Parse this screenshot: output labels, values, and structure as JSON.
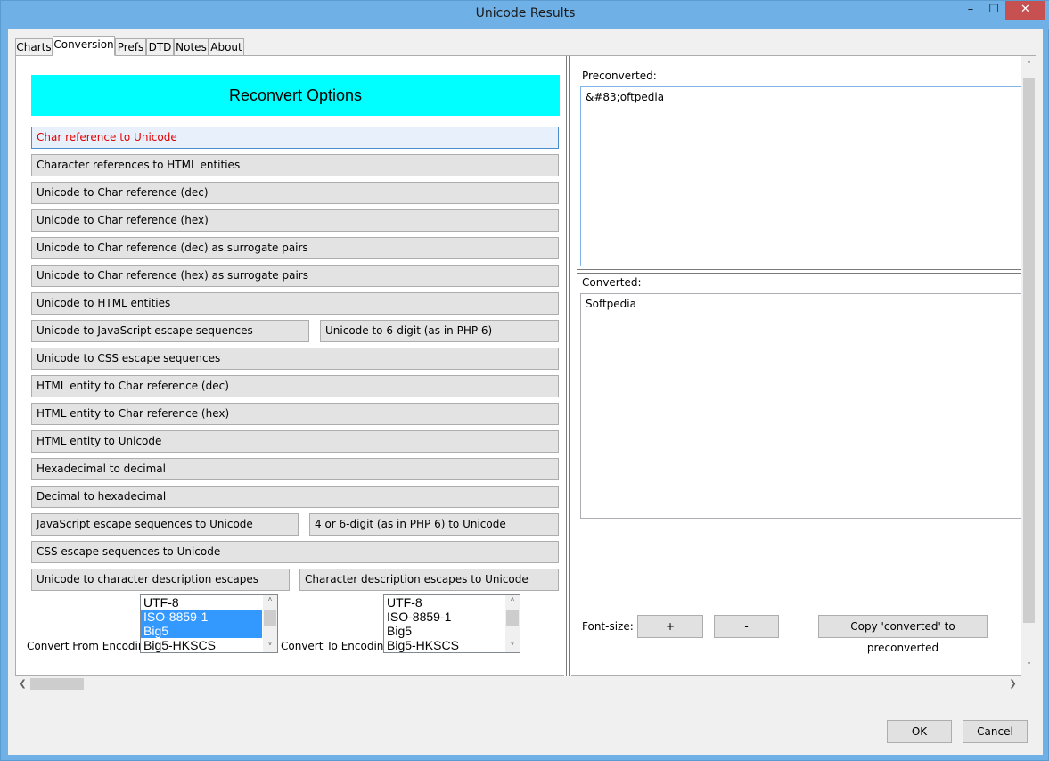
{
  "window": {
    "title": "Unicode Results",
    "minimize_glyph": "–",
    "maximize_glyph": "☐",
    "close_glyph": "✕"
  },
  "tabs": [
    {
      "label": "Charts",
      "active": false
    },
    {
      "label": "Conversion",
      "active": true
    },
    {
      "label": "Prefs",
      "active": false
    },
    {
      "label": "DTD",
      "active": false
    },
    {
      "label": "Notes",
      "active": false
    },
    {
      "label": "About",
      "active": false
    }
  ],
  "conversion": {
    "banner": "Reconvert Options",
    "banner_color": "#00ffff",
    "buttons": [
      "Char reference to Unicode",
      "Character references to HTML entities",
      "Unicode to Char reference (dec)",
      "Unicode to Char reference (hex)",
      "Unicode to Char reference (dec) as surrogate pairs",
      "Unicode to Char reference (hex) as surrogate pairs",
      "Unicode to HTML entities",
      "Unicode to JavaScript escape sequences",
      "Unicode to 6-digit (as in PHP 6)",
      "Unicode to CSS escape sequences",
      "HTML entity to Char reference (dec)",
      "HTML entity to Char reference (hex)",
      "HTML entity to Unicode",
      "Hexadecimal to decimal",
      "Decimal to hexadecimal",
      "JavaScript escape sequences to Unicode",
      "4 or 6-digit (as in PHP 6) to Unicode",
      "CSS escape sequences to Unicode",
      "Unicode to character description escapes",
      "Character description escapes to Unicode"
    ],
    "selected_color": "#e00000",
    "from_label": "Convert From Encoding",
    "to_label": "Convert To Encoding",
    "from_options": [
      {
        "label": "UTF-8",
        "selected": false
      },
      {
        "label": "ISO-8859-1",
        "selected": true
      },
      {
        "label": "Big5",
        "selected": true
      },
      {
        "label": "Big5-HKSCS",
        "selected": false
      }
    ],
    "to_options": [
      {
        "label": "UTF-8",
        "selected": false
      },
      {
        "label": "ISO-8859-1",
        "selected": false
      },
      {
        "label": "Big5",
        "selected": false
      },
      {
        "label": "Big5-HKSCS",
        "selected": false
      }
    ]
  },
  "results": {
    "preconverted_label": "Preconverted:",
    "preconverted_value": "&#83;oftpedia",
    "converted_label": "Converted:",
    "converted_value": "Softpedia",
    "font_size_label": "Font-size:",
    "increase_label": "+",
    "decrease_label": "-",
    "copy_label": "Copy 'converted' to preconverted"
  },
  "scroll": {
    "up_glyph": "˄",
    "down_glyph": "˅",
    "left_glyph": "❮",
    "right_glyph": "❯"
  },
  "dialog": {
    "ok_label": "OK",
    "cancel_label": "Cancel"
  }
}
